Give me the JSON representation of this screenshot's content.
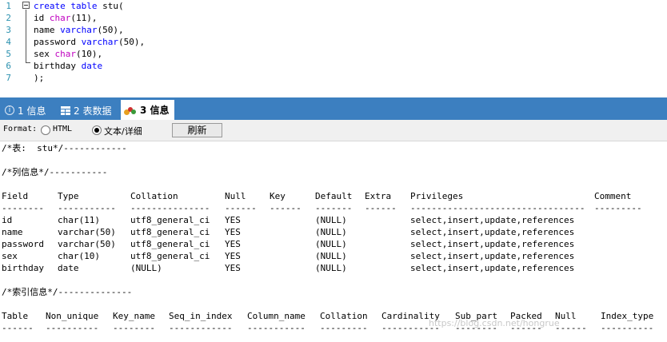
{
  "editor": {
    "line_numbers": [
      "1",
      "2",
      "3",
      "4",
      "5",
      "6",
      "7"
    ],
    "lines": [
      {
        "kw1": "create",
        "plain1": " ",
        "kw2": "table",
        "plain2": " stu("
      },
      {
        "name": "id",
        "type": "char",
        "size": "(11),"
      },
      {
        "name": "name",
        "type": "varchar",
        "size": "(50),"
      },
      {
        "name": "password",
        "type": "varchar",
        "size": "(50),"
      },
      {
        "name": "sex",
        "type": "char",
        "size": "(10),"
      },
      {
        "name": "birthday",
        "type": "date",
        "size": ""
      },
      {
        "text": ");"
      }
    ]
  },
  "tabs": [
    {
      "label": "1 信息",
      "icon": "info-icon"
    },
    {
      "label": "2 表数据",
      "icon": "table-grid-icon"
    },
    {
      "label": "3 信息",
      "icon": "chart-bubbles-icon"
    }
  ],
  "format": {
    "label": "Format:",
    "options": [
      "HTML",
      "文本/详细"
    ],
    "selected": "文本/详细",
    "refresh": "刷新"
  },
  "output": {
    "table_header": "/*表:  stu*/------------",
    "columns_header": "/*列信息*/-----------",
    "col_names": [
      "Field",
      "Type",
      "Collation",
      "Null",
      "Key",
      "Default",
      "Extra",
      "Privileges",
      "Comment"
    ],
    "col_dashes": [
      "--------",
      "-----------",
      "---------------",
      "------",
      "------",
      "-------",
      "------",
      "---------------------------------",
      "---------"
    ],
    "rows": [
      [
        "id",
        "char(11)",
        "utf8_general_ci",
        "YES",
        "",
        "(NULL)",
        "",
        "select,insert,update,references",
        ""
      ],
      [
        "name",
        "varchar(50)",
        "utf8_general_ci",
        "YES",
        "",
        "(NULL)",
        "",
        "select,insert,update,references",
        ""
      ],
      [
        "password",
        "varchar(50)",
        "utf8_general_ci",
        "YES",
        "",
        "(NULL)",
        "",
        "select,insert,update,references",
        ""
      ],
      [
        "sex",
        "char(10)",
        "utf8_general_ci",
        "YES",
        "",
        "(NULL)",
        "",
        "select,insert,update,references",
        ""
      ],
      [
        "birthday",
        "date",
        "(NULL)",
        "YES",
        "",
        "(NULL)",
        "",
        "select,insert,update,references",
        ""
      ]
    ],
    "index_header": "/*索引信息*/--------------",
    "idx_names": [
      "Table",
      "Non_unique",
      "Key_name",
      "Seq_in_index",
      "Column_name",
      "Collation",
      "Cardinality",
      "Sub_part",
      "Packed",
      "Null",
      "Index_type"
    ],
    "idx_dashes": [
      "------",
      "----------",
      "--------",
      "------------",
      "-----------",
      "---------",
      "-----------",
      "--------",
      "------",
      "------",
      "----------"
    ],
    "watermark": "https://blog.csdn.net/hongrue"
  },
  "colors": {
    "tabbar": "#3c7fc0",
    "keyword": "#0000ff",
    "type": "#c000c0",
    "line_number": "#2b91af"
  }
}
